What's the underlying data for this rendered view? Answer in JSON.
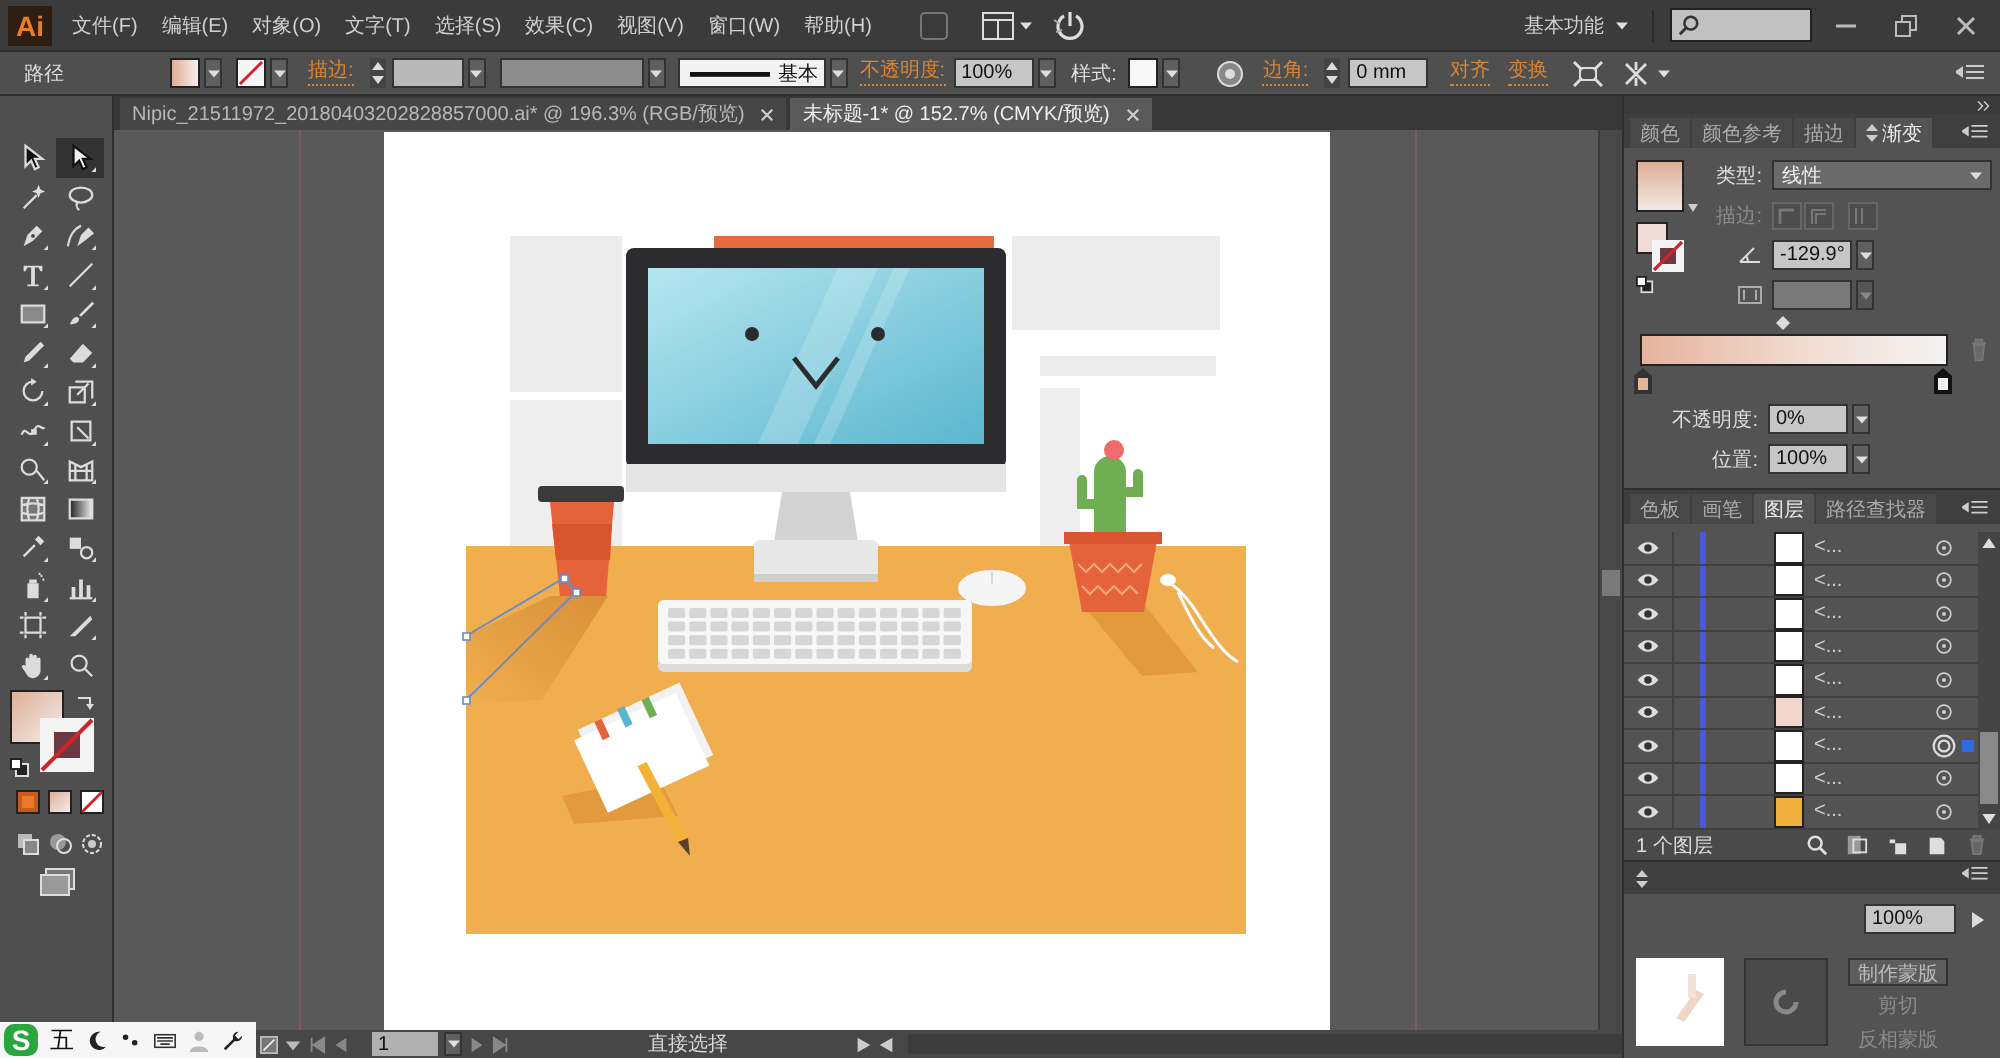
{
  "app_logo": "Ai",
  "menu": [
    "文件(F)",
    "编辑(E)",
    "对象(O)",
    "文字(T)",
    "选择(S)",
    "效果(C)",
    "视图(V)",
    "窗口(W)",
    "帮助(H)"
  ],
  "workspace": "基本功能",
  "control_bar": {
    "selection": "路径",
    "stroke_link": "描边:",
    "stroke_style": "基本",
    "opacity_link": "不透明度:",
    "opacity": "100%",
    "style_label": "样式:",
    "corner_link": "边角:",
    "corner": "0 mm",
    "align_link": "对齐",
    "transform_link": "变换"
  },
  "doc_tabs": [
    {
      "title": "Nipic_21511972_20180403202828857000.ai* @ 196.3% (RGB/预览)",
      "selected": false
    },
    {
      "title": "未标题-1* @ 152.7% (CMYK/预览)",
      "selected": true
    }
  ],
  "tools": [
    {
      "kind": "selection",
      "selected": false
    },
    {
      "kind": "direct-selection",
      "selected": true
    },
    {
      "kind": "magic-wand",
      "selected": false
    },
    {
      "kind": "lasso",
      "selected": false
    },
    {
      "kind": "pen",
      "selected": false
    },
    {
      "kind": "curvature-pen",
      "selected": false
    },
    {
      "kind": "type",
      "selected": false
    },
    {
      "kind": "line",
      "selected": false
    },
    {
      "kind": "rectangle",
      "selected": false
    },
    {
      "kind": "paintbrush",
      "selected": false
    },
    {
      "kind": "pencil",
      "selected": false
    },
    {
      "kind": "eraser",
      "selected": false
    },
    {
      "kind": "rotate",
      "selected": false
    },
    {
      "kind": "scale",
      "selected": false
    },
    {
      "kind": "width",
      "selected": false
    },
    {
      "kind": "free-transform",
      "selected": false
    },
    {
      "kind": "shape-builder",
      "selected": false
    },
    {
      "kind": "perspective-grid",
      "selected": false
    },
    {
      "kind": "mesh",
      "selected": false
    },
    {
      "kind": "gradient",
      "selected": false
    },
    {
      "kind": "eyedropper",
      "selected": false
    },
    {
      "kind": "blend",
      "selected": false
    },
    {
      "kind": "symbol-sprayer",
      "selected": false
    },
    {
      "kind": "column-graph",
      "selected": false
    },
    {
      "kind": "artboard",
      "selected": false
    },
    {
      "kind": "slice",
      "selected": false
    },
    {
      "kind": "hand",
      "selected": false
    },
    {
      "kind": "zoom",
      "selected": false
    }
  ],
  "gradient_panel": {
    "tabs": [
      {
        "label": "颜色",
        "selected": false,
        "toggle": false
      },
      {
        "label": "颜色参考",
        "selected": false,
        "toggle": false
      },
      {
        "label": "描边",
        "selected": false,
        "toggle": false
      },
      {
        "label": "渐变",
        "selected": true,
        "toggle": true
      }
    ],
    "type_label": "类型:",
    "type": "线性",
    "stroke_label": "描边:",
    "angle": "-129.9°",
    "opacity_label": "不透明度:",
    "opacity": "0%",
    "location_label": "位置:",
    "location": "100%"
  },
  "layers_panel": {
    "tabs": [
      {
        "label": "色板",
        "selected": false
      },
      {
        "label": "画笔",
        "selected": false
      },
      {
        "label": "图层",
        "selected": true
      },
      {
        "label": "路径查找器",
        "selected": false
      }
    ],
    "rows": [
      {
        "name": "<...",
        "visible": true,
        "selected": false,
        "color": "#ffffff"
      },
      {
        "name": "<...",
        "visible": true,
        "selected": false,
        "color": "#ffffff"
      },
      {
        "name": "<...",
        "visible": true,
        "selected": false,
        "color": "#ffffff"
      },
      {
        "name": "<...",
        "visible": true,
        "selected": false,
        "color": "#ffffff"
      },
      {
        "name": "<...",
        "visible": true,
        "selected": false,
        "color": "#ffffff"
      },
      {
        "name": "<...",
        "visible": true,
        "selected": false,
        "color": "#f2d6cc"
      },
      {
        "name": "<...",
        "visible": true,
        "selected": true,
        "color": "#ffffff"
      },
      {
        "name": "<...",
        "visible": true,
        "selected": false,
        "color": "#ffffff"
      },
      {
        "name": "<...",
        "visible": true,
        "selected": false,
        "color": "#f0b040"
      }
    ],
    "count": "1 个图层"
  },
  "transparency_panel": {
    "opacity": "100%",
    "make_mask": "制作蒙版",
    "clip": "剪切",
    "invert_mask": "反相蒙版"
  },
  "status_bar": {
    "page": "1",
    "tool": "直接选择"
  },
  "ime_bar": {
    "logo": "S",
    "mode": "五"
  }
}
